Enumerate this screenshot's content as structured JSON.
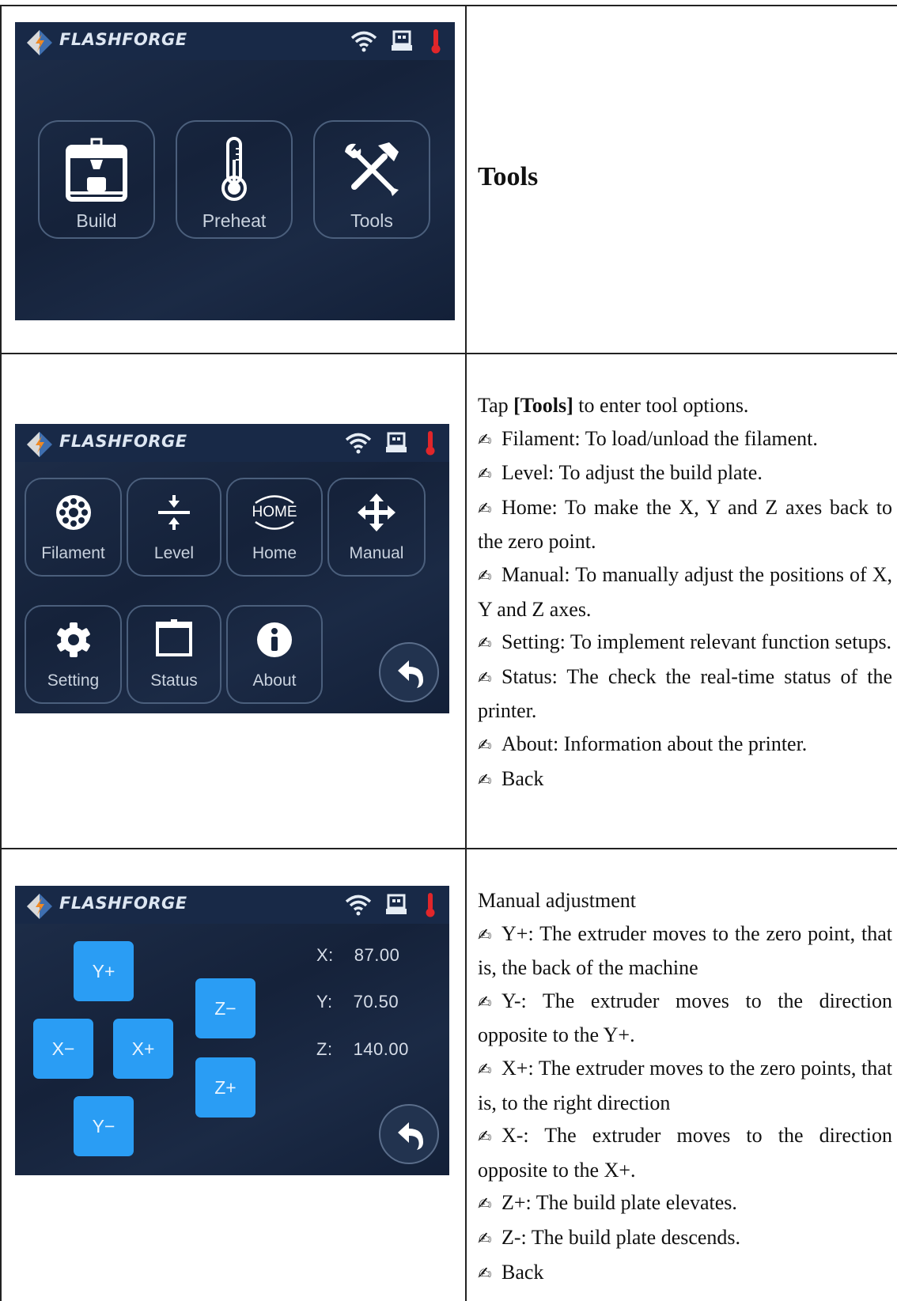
{
  "section1": {
    "screen": {
      "brand": "FLASHFORGE",
      "tiles": [
        {
          "label": "Build",
          "icon": "build-icon"
        },
        {
          "label": "Preheat",
          "icon": "thermometer-icon"
        },
        {
          "label": "Tools",
          "icon": "tools-icon"
        }
      ]
    },
    "title": "Tools"
  },
  "section2": {
    "screen": {
      "brand": "FLASHFORGE",
      "tiles": [
        {
          "label": "Filament",
          "icon": "filament-icon"
        },
        {
          "label": "Level",
          "icon": "level-icon"
        },
        {
          "label": "Home",
          "icon": "home-icon",
          "icon_text": "HOME"
        },
        {
          "label": "Manual",
          "icon": "move-icon"
        },
        {
          "label": "Setting",
          "icon": "gear-icon"
        },
        {
          "label": "Status",
          "icon": "status-icon"
        },
        {
          "label": "About",
          "icon": "info-icon"
        }
      ]
    },
    "intro_pre": "Tap ",
    "intro_bold": "[Tools]",
    "intro_post": " to enter tool options.",
    "items": [
      "Filament: To load/unload the filament.",
      "Level: To adjust the build plate.",
      "Home: To make the X, Y and Z axes back to the zero point.",
      "Manual: To manually adjust the positions of X, Y and Z axes.",
      "Setting: To implement relevant function setups.",
      "Status: The check the real-time status of the printer.",
      "About: Information about the printer.",
      "Back"
    ]
  },
  "section3": {
    "screen": {
      "brand": "FLASHFORGE",
      "buttons": {
        "y_plus": "Y+",
        "y_minus": "Y−",
        "x_minus": "X−",
        "x_plus": "X+",
        "z_minus": "Z−",
        "z_plus": "Z+"
      },
      "coords": [
        {
          "label": "X:",
          "value": "87.00"
        },
        {
          "label": "Y:",
          "value": "70.50"
        },
        {
          "label": "Z:",
          "value": "140.00"
        }
      ]
    },
    "heading": "Manual adjustment",
    "items": [
      "Y+: The extruder moves to the zero point, that is, the back of the machine",
      "Y-: The extruder moves to the direction opposite to the Y+.",
      "X+: The extruder moves to the zero points, that is, to the right direction",
      "X-: The extruder moves to the direction opposite to the X+.",
      "Z+: The build plate elevates.",
      "Z-: The build plate descends.",
      "Back"
    ]
  },
  "bullet_mark": "✍"
}
